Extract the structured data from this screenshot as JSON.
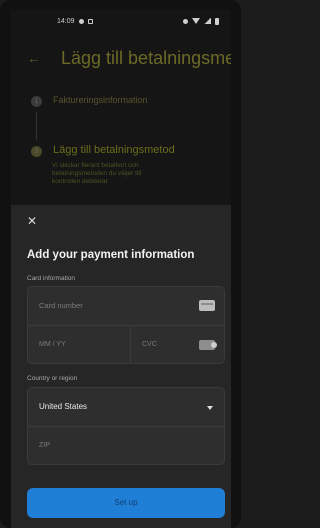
{
  "status_bar": {
    "time": "14:09"
  },
  "background_screen": {
    "title": "Lägg till betalningsmetod",
    "steps": [
      {
        "number": "1",
        "label": "Faktureringsinformation"
      },
      {
        "number": "2",
        "label": "Lägg till betalningsmetod"
      }
    ],
    "step_description": "Vi skickar fler­ant betalkort och betalningsmetoden du väljer till kontrollen debiterat"
  },
  "sheet": {
    "title": "Add your payment information",
    "card_section_label": "Card information",
    "card_number_placeholder": "Card number",
    "expiry_placeholder": "MM / YY",
    "cvc_placeholder": "CVC",
    "country_section_label": "Country or region",
    "country_value": "United States",
    "zip_placeholder": "ZIP",
    "submit_label": "Set up"
  },
  "colors": {
    "accent": "#1f7fd6",
    "sheet_bg": "#262626",
    "field_bg": "#2e2e2e"
  },
  "icons": [
    "back-arrow-icon",
    "close-icon",
    "card-icon",
    "cvc-icon",
    "chevron-down-icon"
  ]
}
